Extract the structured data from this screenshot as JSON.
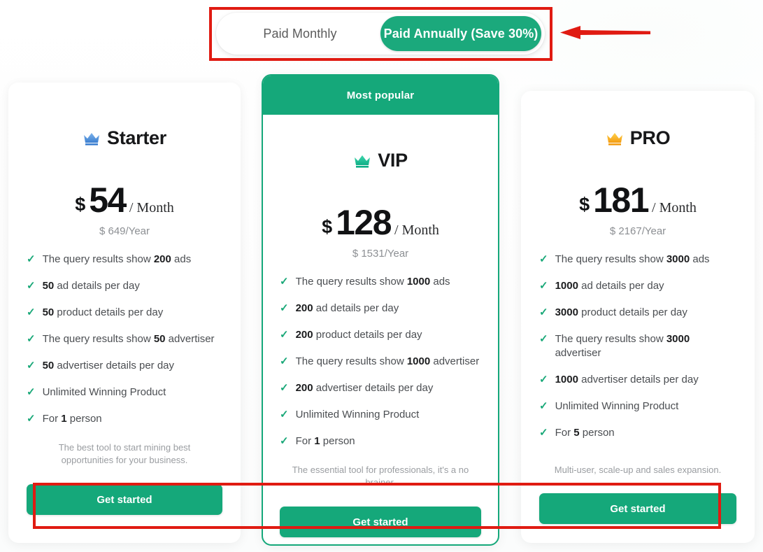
{
  "billing_toggle": {
    "monthly_label": "Paid Monthly",
    "annually_label": "Paid Annually (Save 30%)",
    "active": "annually",
    "active_color": "#1ba97c"
  },
  "annotations": {
    "color": "#e01b12",
    "toggle_highlight": "billing-toggle-highlight",
    "buttons_highlight": "get-started-buttons-highlight",
    "arrow": "left-pointing-arrow-to-toggle"
  },
  "plans": [
    {
      "id": "starter",
      "name": "Starter",
      "crown_icon": "crown-icon-blue",
      "crown_color": "#4a90e2",
      "badge": null,
      "currency": "$",
      "amount": "54",
      "period": "/ Month",
      "year_price": "$ 649/Year",
      "features": [
        {
          "pre": "The query results show ",
          "bold": "200",
          "post": " ads"
        },
        {
          "pre": "",
          "bold": "50",
          "post": " ad details per day"
        },
        {
          "pre": "",
          "bold": "50",
          "post": " product details per day"
        },
        {
          "pre": "The query results show ",
          "bold": "50",
          "post": " advertiser"
        },
        {
          "pre": "",
          "bold": "50",
          "post": " advertiser details per day"
        },
        {
          "pre": "Unlimited Winning Product",
          "bold": "",
          "post": ""
        },
        {
          "pre": "For ",
          "bold": "1",
          "post": " person"
        }
      ],
      "tagline": "The best tool to start mining best opportunities for your business.",
      "cta_label": "Get started"
    },
    {
      "id": "vip",
      "name": "VIP",
      "crown_icon": "crown-icon-teal",
      "crown_color": "#15b894",
      "badge": "Most popular",
      "currency": "$",
      "amount": "128",
      "period": "/ Month",
      "year_price": "$ 1531/Year",
      "features": [
        {
          "pre": "The query results show ",
          "bold": "1000",
          "post": " ads"
        },
        {
          "pre": "",
          "bold": "200",
          "post": " ad details per day"
        },
        {
          "pre": "",
          "bold": "200",
          "post": " product details per day"
        },
        {
          "pre": "The query results show ",
          "bold": "1000",
          "post": " advertiser"
        },
        {
          "pre": "",
          "bold": "200",
          "post": " advertiser details per day"
        },
        {
          "pre": "Unlimited Winning Product",
          "bold": "",
          "post": ""
        },
        {
          "pre": "For ",
          "bold": "1",
          "post": " person"
        }
      ],
      "tagline": "The essential tool for professionals, it's a no brainer.",
      "cta_label": "Get started"
    },
    {
      "id": "pro",
      "name": "PRO",
      "crown_icon": "crown-icon-gold",
      "crown_color": "#f5a623",
      "badge": null,
      "currency": "$",
      "amount": "181",
      "period": "/ Month",
      "year_price": "$ 2167/Year",
      "features": [
        {
          "pre": "The query results show ",
          "bold": "3000",
          "post": " ads"
        },
        {
          "pre": "",
          "bold": "1000",
          "post": " ad details per day"
        },
        {
          "pre": "",
          "bold": "3000",
          "post": " product details per day"
        },
        {
          "pre": "The query results show ",
          "bold": "3000",
          "post": " advertiser"
        },
        {
          "pre": "",
          "bold": "1000",
          "post": " advertiser details per day"
        },
        {
          "pre": "Unlimited Winning Product",
          "bold": "",
          "post": ""
        },
        {
          "pre": "For ",
          "bold": "5",
          "post": " person"
        }
      ],
      "tagline": "Multi-user, scale-up and sales expansion.",
      "cta_label": "Get started"
    }
  ],
  "theme": {
    "brand_green": "#15a87a",
    "tick_color": "#19a878",
    "muted_text": "#9a9da1"
  }
}
